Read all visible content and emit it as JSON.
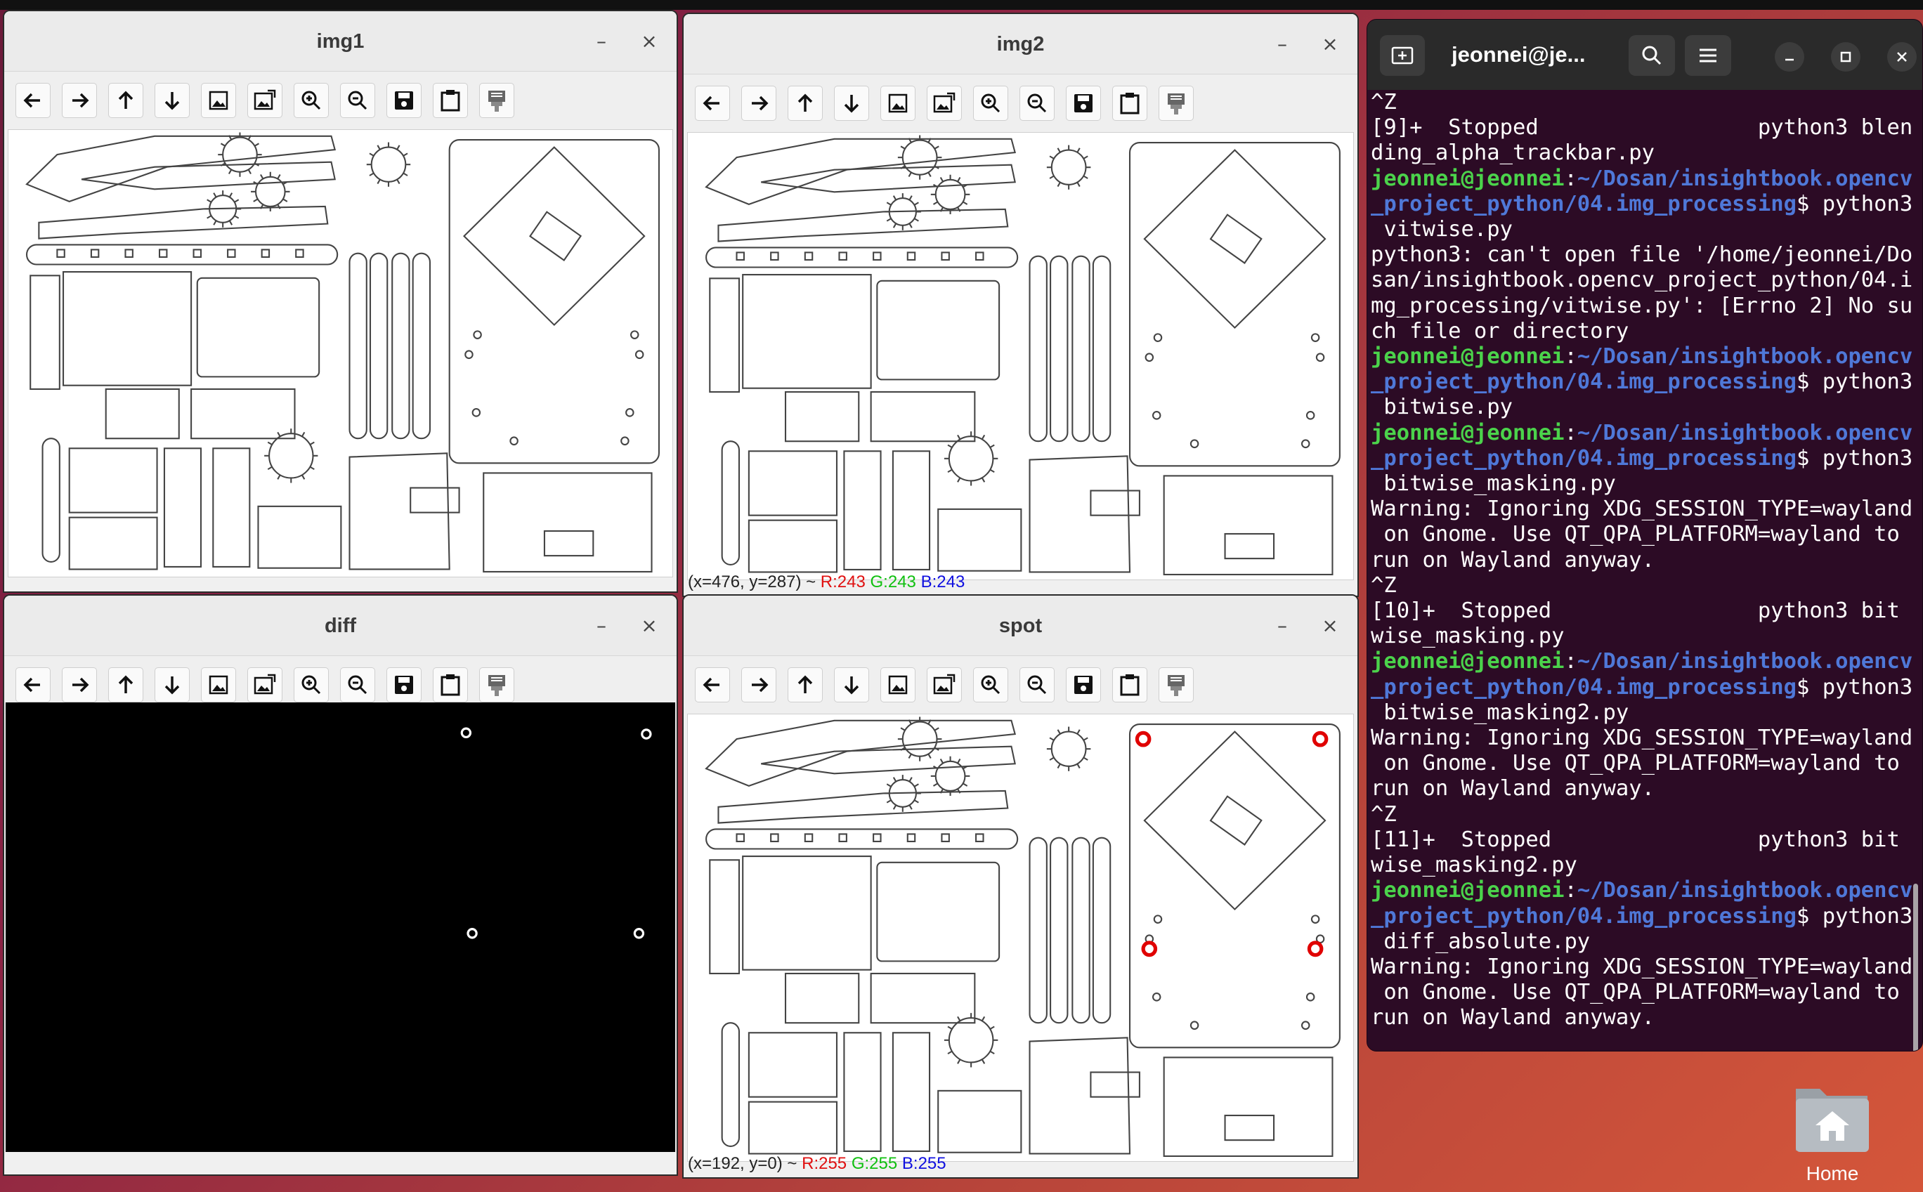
{
  "windows": {
    "img1": {
      "title": "img1",
      "status": null
    },
    "img2": {
      "title": "img2",
      "status": {
        "coords": "(x=476, y=287) ~",
        "r": "R:243",
        "g": "G:243",
        "b": "B:243"
      }
    },
    "diff": {
      "title": "diff",
      "status": null
    },
    "spot": {
      "title": "spot",
      "status": {
        "coords": "(x=192, y=0) ~",
        "r": "R:255",
        "g": "G:255",
        "b": "B:255"
      }
    }
  },
  "window_buttons": {
    "minimize": "–",
    "close": "×"
  },
  "toolbar_icons": [
    "arrow-left-icon",
    "arrow-right-icon",
    "arrow-up-icon",
    "arrow-down-icon",
    "image-icon",
    "image-export-icon",
    "zoom-in-icon",
    "zoom-out-icon",
    "save-icon",
    "clipboard-icon",
    "properties-icon"
  ],
  "terminal": {
    "title": "jeonnei@je...",
    "lines": [
      {
        "t": "^Z"
      },
      {
        "t": "[9]+  Stopped                 python3 blen"
      },
      {
        "t": "ding_alpha_trackbar.py"
      },
      {
        "u": "jeonnei@jeonnei",
        "p": "~/Dosan/insightbook.opencv",
        "c": ""
      },
      {
        "p": "_project_python/04.img_processing",
        "c": "$ python3"
      },
      {
        "t": " vitwise.py"
      },
      {
        "t": "python3: can't open file '/home/jeonnei/Do"
      },
      {
        "t": "san/insightbook.opencv_project_python/04.i"
      },
      {
        "t": "mg_processing/vitwise.py': [Errno 2] No su"
      },
      {
        "t": "ch file or directory"
      },
      {
        "u": "jeonnei@jeonnei",
        "p": "~/Dosan/insightbook.opencv",
        "c": ""
      },
      {
        "p": "_project_python/04.img_processing",
        "c": "$ python3"
      },
      {
        "t": " bitwise.py"
      },
      {
        "u": "jeonnei@jeonnei",
        "p": "~/Dosan/insightbook.opencv",
        "c": ""
      },
      {
        "p": "_project_python/04.img_processing",
        "c": "$ python3"
      },
      {
        "t": " bitwise_masking.py"
      },
      {
        "t": "Warning: Ignoring XDG_SESSION_TYPE=wayland"
      },
      {
        "t": " on Gnome. Use QT_QPA_PLATFORM=wayland to"
      },
      {
        "t": "run on Wayland anyway."
      },
      {
        "t": "^Z"
      },
      {
        "t": "[10]+  Stopped                python3 bit"
      },
      {
        "t": "wise_masking.py"
      },
      {
        "u": "jeonnei@jeonnei",
        "p": "~/Dosan/insightbook.opencv",
        "c": ""
      },
      {
        "p": "_project_python/04.img_processing",
        "c": "$ python3"
      },
      {
        "t": " bitwise_masking2.py"
      },
      {
        "t": "Warning: Ignoring XDG_SESSION_TYPE=wayland"
      },
      {
        "t": " on Gnome. Use QT_QPA_PLATFORM=wayland to"
      },
      {
        "t": "run on Wayland anyway."
      },
      {
        "t": "^Z"
      },
      {
        "t": "[11]+  Stopped                python3 bit"
      },
      {
        "t": "wise_masking2.py"
      },
      {
        "u": "jeonnei@jeonnei",
        "p": "~/Dosan/insightbook.opencv",
        "c": ""
      },
      {
        "p": "_project_python/04.img_processing",
        "c": "$ python3"
      },
      {
        "t": " diff_absolute.py"
      },
      {
        "t": "Warning: Ignoring XDG_SESSION_TYPE=wayland"
      },
      {
        "t": " on Gnome. Use QT_QPA_PLATFORM=wayland to"
      },
      {
        "t": "run on Wayland anyway."
      }
    ]
  },
  "desktop": {
    "home_label": "Home"
  },
  "colors": {
    "terminal_bg": "#2c0b25",
    "user_green": "#4bd34b",
    "path_blue": "#4f78d8",
    "marker_red": "#e00000"
  }
}
